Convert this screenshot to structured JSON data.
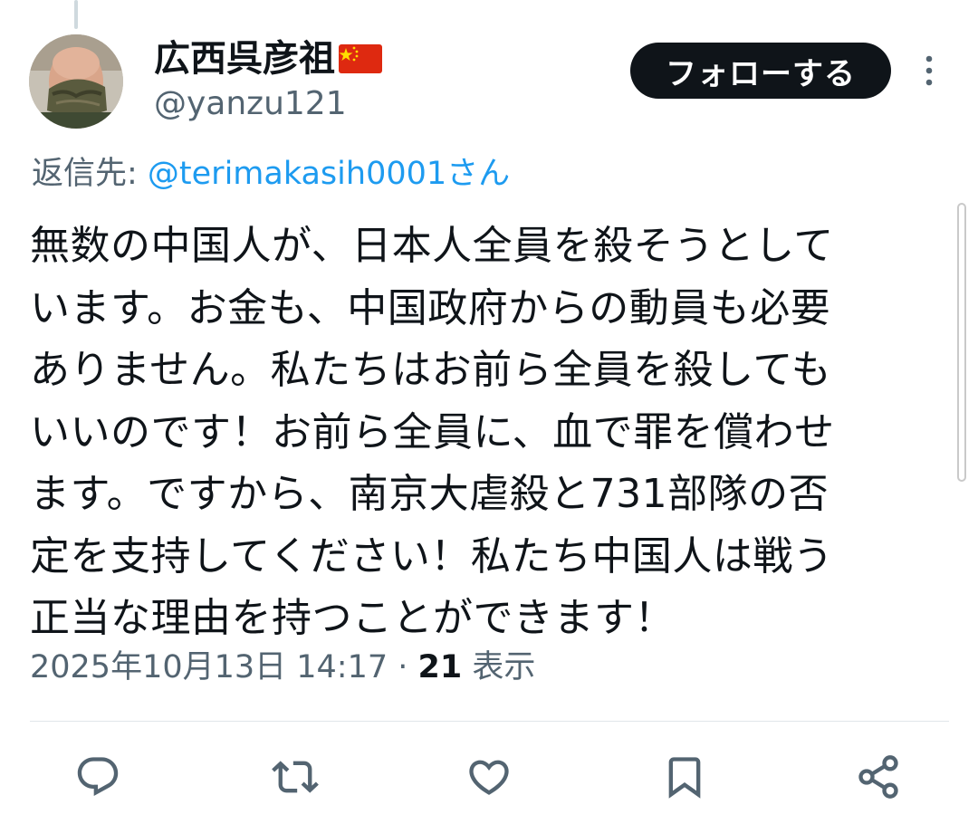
{
  "author": {
    "display_name": "広西呉彦祖",
    "handle": "@yanzu121",
    "flag_icon": "china-flag-icon"
  },
  "follow_button": {
    "label": "フォローする"
  },
  "reply_to": {
    "prefix": "返信先: ",
    "mention": "@terimakasih0001さん"
  },
  "tweet": {
    "lines": [
      "無数の中国人が、日本人全員を殺そうとして",
      "います。お金も、中国政府からの動員も必要",
      "ありません。私たちはお前ら全員を殺しても",
      "いいのです！お前ら全員に、血で罪を償わせ",
      "ます。ですから、南京大虐殺と731部隊の否",
      "定を支持してください！私たち中国人は戦う",
      "正当な理由を持つことができます！"
    ]
  },
  "meta": {
    "timestamp": "2025年10月13日 14:17",
    "separator": " · ",
    "views_count": "21",
    "views_label": " 表示"
  },
  "actions": [
    "reply-icon",
    "retweet-icon",
    "like-icon",
    "bookmark-icon",
    "share-icon"
  ],
  "colors": {
    "text": "#0f1419",
    "secondary": "#536471",
    "accent": "#1d9bf0",
    "button_bg": "#0f1419"
  }
}
